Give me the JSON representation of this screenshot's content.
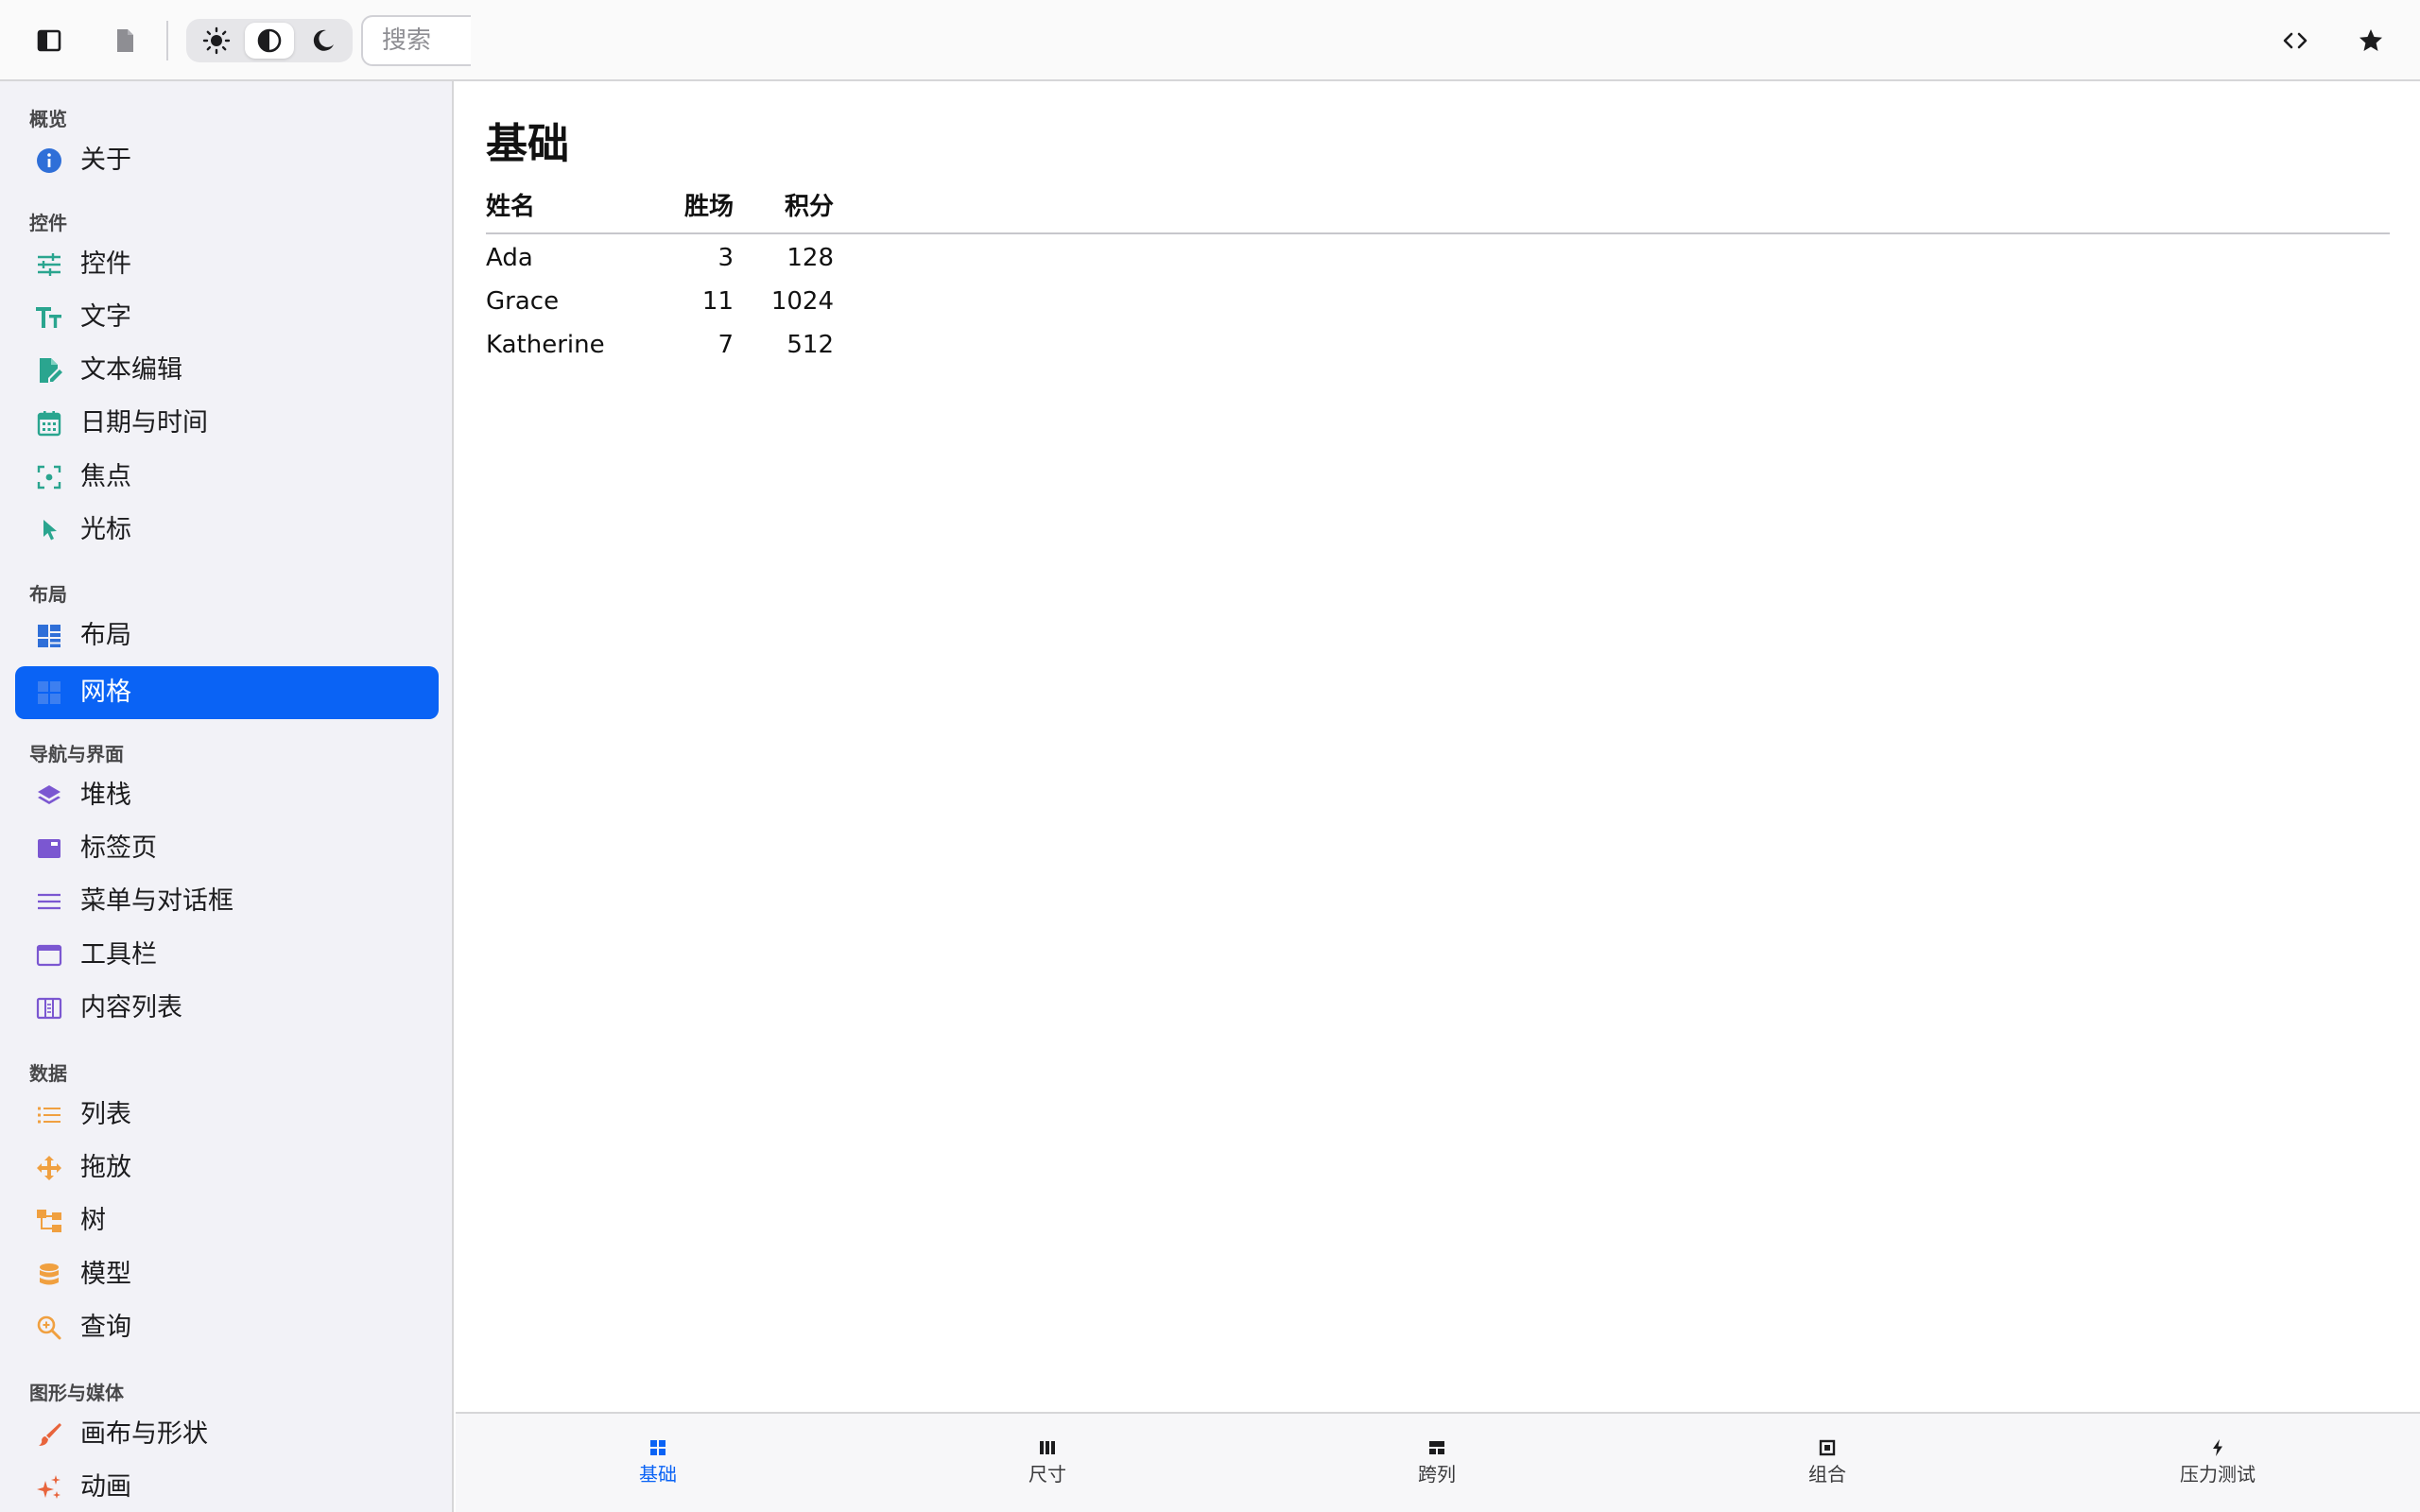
{
  "toolbar": {
    "search_placeholder": "搜索"
  },
  "sidebar": {
    "sections": [
      {
        "title": "概览",
        "items": [
          {
            "label": "关于",
            "icon": "info-icon"
          }
        ]
      },
      {
        "title": "控件",
        "items": [
          {
            "label": "控件",
            "icon": "sliders-icon"
          },
          {
            "label": "文字",
            "icon": "text-icon"
          },
          {
            "label": "文本编辑",
            "icon": "edit-document-icon"
          },
          {
            "label": "日期与时间",
            "icon": "calendar-icon"
          },
          {
            "label": "焦点",
            "icon": "focus-icon"
          },
          {
            "label": "光标",
            "icon": "cursor-icon"
          }
        ]
      },
      {
        "title": "布局",
        "items": [
          {
            "label": "布局",
            "icon": "dashboard-icon"
          },
          {
            "label": "网格",
            "icon": "grid-icon"
          }
        ]
      },
      {
        "title": "导航与界面",
        "items": [
          {
            "label": "堆栈",
            "icon": "layers-icon"
          },
          {
            "label": "标签页",
            "icon": "tab-icon"
          },
          {
            "label": "菜单与对话框",
            "icon": "menu-icon"
          },
          {
            "label": "工具栏",
            "icon": "window-icon"
          },
          {
            "label": "内容列表",
            "icon": "columns-icon"
          }
        ]
      },
      {
        "title": "数据",
        "items": [
          {
            "label": "列表",
            "icon": "list-icon"
          },
          {
            "label": "拖放",
            "icon": "move-icon"
          },
          {
            "label": "树",
            "icon": "tree-icon"
          },
          {
            "label": "模型",
            "icon": "database-icon"
          },
          {
            "label": "查询",
            "icon": "search-zoom-icon"
          }
        ]
      },
      {
        "title": "图形与媒体",
        "items": [
          {
            "label": "画布与形状",
            "icon": "brush-icon"
          },
          {
            "label": "动画",
            "icon": "sparkle-icon"
          }
        ]
      }
    ],
    "active_item": "网格"
  },
  "main": {
    "title": "基础",
    "table": {
      "headers": [
        "姓名",
        "胜场",
        "积分"
      ],
      "rows": [
        [
          "Ada",
          "3",
          "128"
        ],
        [
          "Grace",
          "11",
          "1024"
        ],
        [
          "Katherine",
          "7",
          "512"
        ]
      ]
    }
  },
  "tabbar": {
    "tabs": [
      {
        "label": "基础",
        "icon": "grid-icon"
      },
      {
        "label": "尺寸",
        "icon": "columns-icon"
      },
      {
        "label": "跨列",
        "icon": "span-icon"
      },
      {
        "label": "组合",
        "icon": "square-dot-icon"
      },
      {
        "label": "压力测试",
        "icon": "bolt-icon"
      }
    ],
    "selected": "基础"
  },
  "colors": {
    "accent": "#0a63f5",
    "section_green": "#2aa58f",
    "section_blue": "#2f6fd8",
    "section_purple": "#7b57d1",
    "section_orange": "#f0a040",
    "section_red": "#e8643c"
  }
}
